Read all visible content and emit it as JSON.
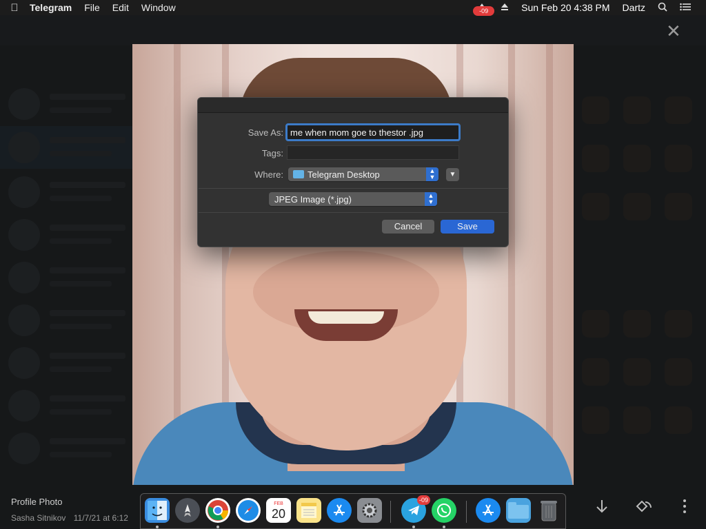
{
  "menubar": {
    "app_name": "Telegram",
    "menus": [
      "File",
      "Edit",
      "Window"
    ],
    "clock": "Sun Feb 20  4:38 PM",
    "user": "Dartz",
    "status_badge": "-09"
  },
  "dialog": {
    "save_as_label": "Save As:",
    "save_as_value": "me when mom goe to thestor .jpg",
    "tags_label": "Tags:",
    "tags_value": "",
    "where_label": "Where:",
    "where_value": "Telegram Desktop",
    "format_value": "JPEG Image (*.jpg)",
    "cancel_label": "Cancel",
    "save_label": "Save"
  },
  "viewer": {
    "caption_title": "Profile Photo",
    "caption_author": "Sasha Sitnikov",
    "caption_date": "11/7/21 at 6:12"
  },
  "dock": {
    "calendar_month": "FEB",
    "calendar_day": "20",
    "telegram_badge": "-09"
  },
  "colors": {
    "accent": "#2a67d4",
    "dialog_bg": "#323232",
    "focus_ring": "#3c7bc8",
    "badge": "#e23b3b"
  },
  "icons": [
    "apple-icon",
    "ios-indicator-icon",
    "eject-icon",
    "search-icon",
    "list-icon",
    "close-icon",
    "download-icon",
    "rotate-icon",
    "more-icon"
  ]
}
